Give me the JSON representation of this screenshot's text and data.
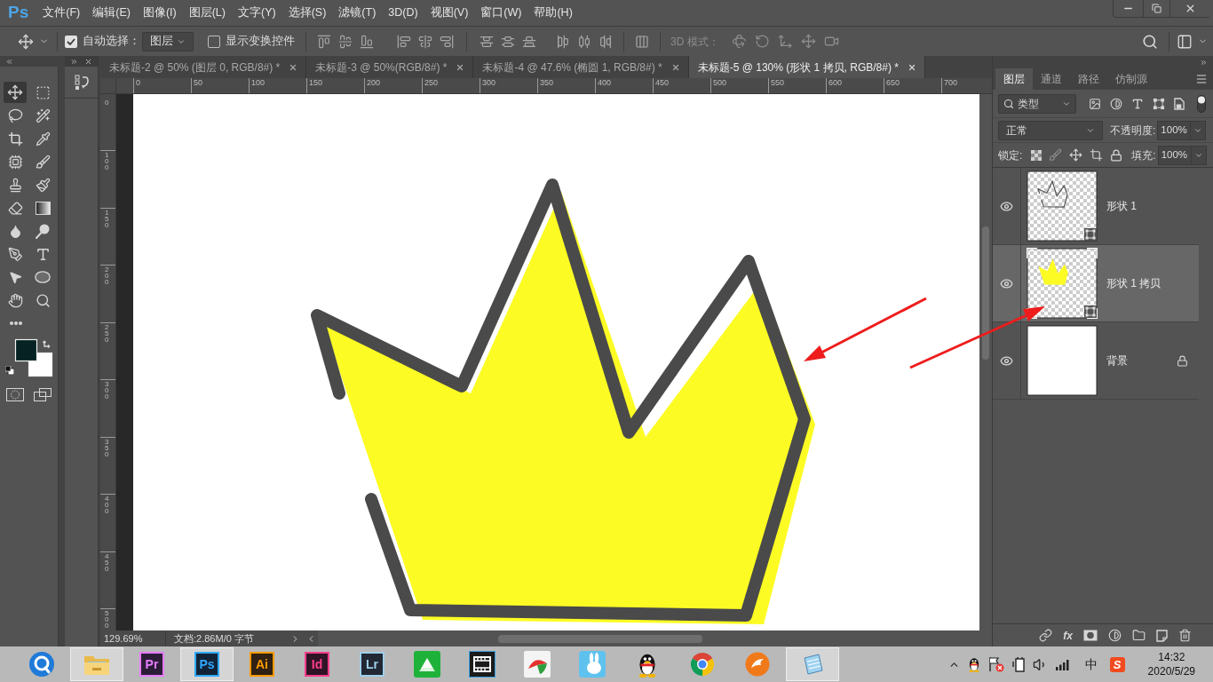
{
  "app": {
    "logo": "Ps"
  },
  "menu": [
    "文件(F)",
    "编辑(E)",
    "图像(I)",
    "图层(L)",
    "文字(Y)",
    "选择(S)",
    "滤镜(T)",
    "3D(D)",
    "视图(V)",
    "窗口(W)",
    "帮助(H)"
  ],
  "options_bar": {
    "auto_select": {
      "label": "自动选择：",
      "checked": true
    },
    "target": {
      "value": "图层"
    },
    "transform_controls": {
      "label": "显示变换控件",
      "checked": false
    },
    "mode_3d": {
      "label": "3D 模式：",
      "disabled": true
    }
  },
  "tools": [
    {
      "kind": "move",
      "selected": true
    },
    {
      "kind": "marquee",
      "selected": false
    },
    {
      "kind": "lasso",
      "selected": false
    },
    {
      "kind": "quickselect",
      "selected": false
    },
    {
      "kind": "crop",
      "selected": false
    },
    {
      "kind": "eyedropper",
      "selected": false
    },
    {
      "kind": "frame",
      "selected": false
    },
    {
      "kind": "brush",
      "selected": false
    },
    {
      "kind": "stamp",
      "selected": false
    },
    {
      "kind": "historybrush",
      "selected": false
    },
    {
      "kind": "eraser",
      "selected": false
    },
    {
      "kind": "gradient",
      "selected": false
    },
    {
      "kind": "blur",
      "selected": false
    },
    {
      "kind": "dodge",
      "selected": false
    },
    {
      "kind": "pen",
      "selected": false
    },
    {
      "kind": "type",
      "selected": false
    },
    {
      "kind": "pathselect",
      "selected": false
    },
    {
      "kind": "ellipse",
      "selected": false
    },
    {
      "kind": "hand",
      "selected": false
    },
    {
      "kind": "zoom",
      "selected": false
    },
    {
      "kind": "more",
      "selected": false
    }
  ],
  "swatches": [
    {
      "kind": "background",
      "color": "#ffffff"
    },
    {
      "kind": "foreground",
      "color": "#062222"
    }
  ],
  "document_tabs": [
    {
      "label": "未标题-2 @ 50% (图层 0, RGB/8#) *",
      "selected": false
    },
    {
      "label": "未标题-3 @ 50%(RGB/8#) *",
      "selected": false
    },
    {
      "label": "未标题-4 @ 47.6% (椭圆 1, RGB/8#) *",
      "selected": false
    },
    {
      "label": "未标题-5 @ 130% (形状 1 拷贝, RGB/8#) *",
      "selected": true
    }
  ],
  "rulers": {
    "horizontal": [
      "0",
      "50",
      "100",
      "150",
      "200",
      "250",
      "300",
      "350",
      "400",
      "450",
      "500",
      "550",
      "600",
      "650",
      "700"
    ],
    "vertical": [
      "0",
      "100",
      "150",
      "200",
      "250",
      "300",
      "350",
      "400",
      "450",
      "500"
    ]
  },
  "status_bar": {
    "zoom": "129.69%",
    "document": "文档:2.86M/0 字节"
  },
  "layers_panel": {
    "tabs": [
      {
        "label": "图层",
        "selected": true
      },
      {
        "label": "通道",
        "selected": false
      },
      {
        "label": "路径",
        "selected": false
      },
      {
        "label": "仿制源",
        "selected": false
      }
    ],
    "filter": "类型",
    "blend_mode": "正常",
    "opacity": {
      "label": "不透明度:",
      "value": "100%"
    },
    "lock_label": "锁定:",
    "fill": {
      "label": "填充:",
      "value": "100%"
    },
    "layers": [
      {
        "name": "形状 1",
        "kind": "outline",
        "visible": true,
        "selected": false,
        "locked": false
      },
      {
        "name": "形状 1 拷贝",
        "kind": "filled",
        "visible": true,
        "selected": true,
        "locked": false
      },
      {
        "name": "背景",
        "kind": "background",
        "visible": true,
        "selected": false,
        "locked": true
      }
    ],
    "footer": {
      "effects_label": "fx"
    }
  },
  "taskbar": {
    "apps": [
      {
        "kind": "browser",
        "highlighted": false
      },
      {
        "kind": "folder",
        "highlighted": true
      },
      {
        "kind": "adobe",
        "label": "Pr",
        "color": "#e77dff",
        "highlighted": false
      },
      {
        "kind": "adobe",
        "label": "Ps",
        "color": "#31a8ff",
        "highlighted": true
      },
      {
        "kind": "adobe",
        "label": "Ai",
        "color": "#ff9a00",
        "highlighted": false
      },
      {
        "kind": "adobe",
        "label": "Id",
        "color": "#ff3d8b",
        "highlighted": false
      },
      {
        "kind": "adobe",
        "label": "Lr",
        "color": "#9fcfea",
        "highlighted": false
      },
      {
        "kind": "drive",
        "highlighted": false
      },
      {
        "kind": "film",
        "highlighted": false
      },
      {
        "kind": "fan",
        "highlighted": false
      },
      {
        "kind": "rabbit",
        "highlighted": false
      },
      {
        "kind": "penguin",
        "highlighted": false
      },
      {
        "kind": "wheel",
        "highlighted": false
      },
      {
        "kind": "fox",
        "highlighted": false
      },
      {
        "kind": "notepad",
        "highlighted": true
      }
    ]
  },
  "tray": {
    "input_method": "中",
    "ime_logo": "S",
    "time": "14:32",
    "date": "2020/5/29"
  }
}
